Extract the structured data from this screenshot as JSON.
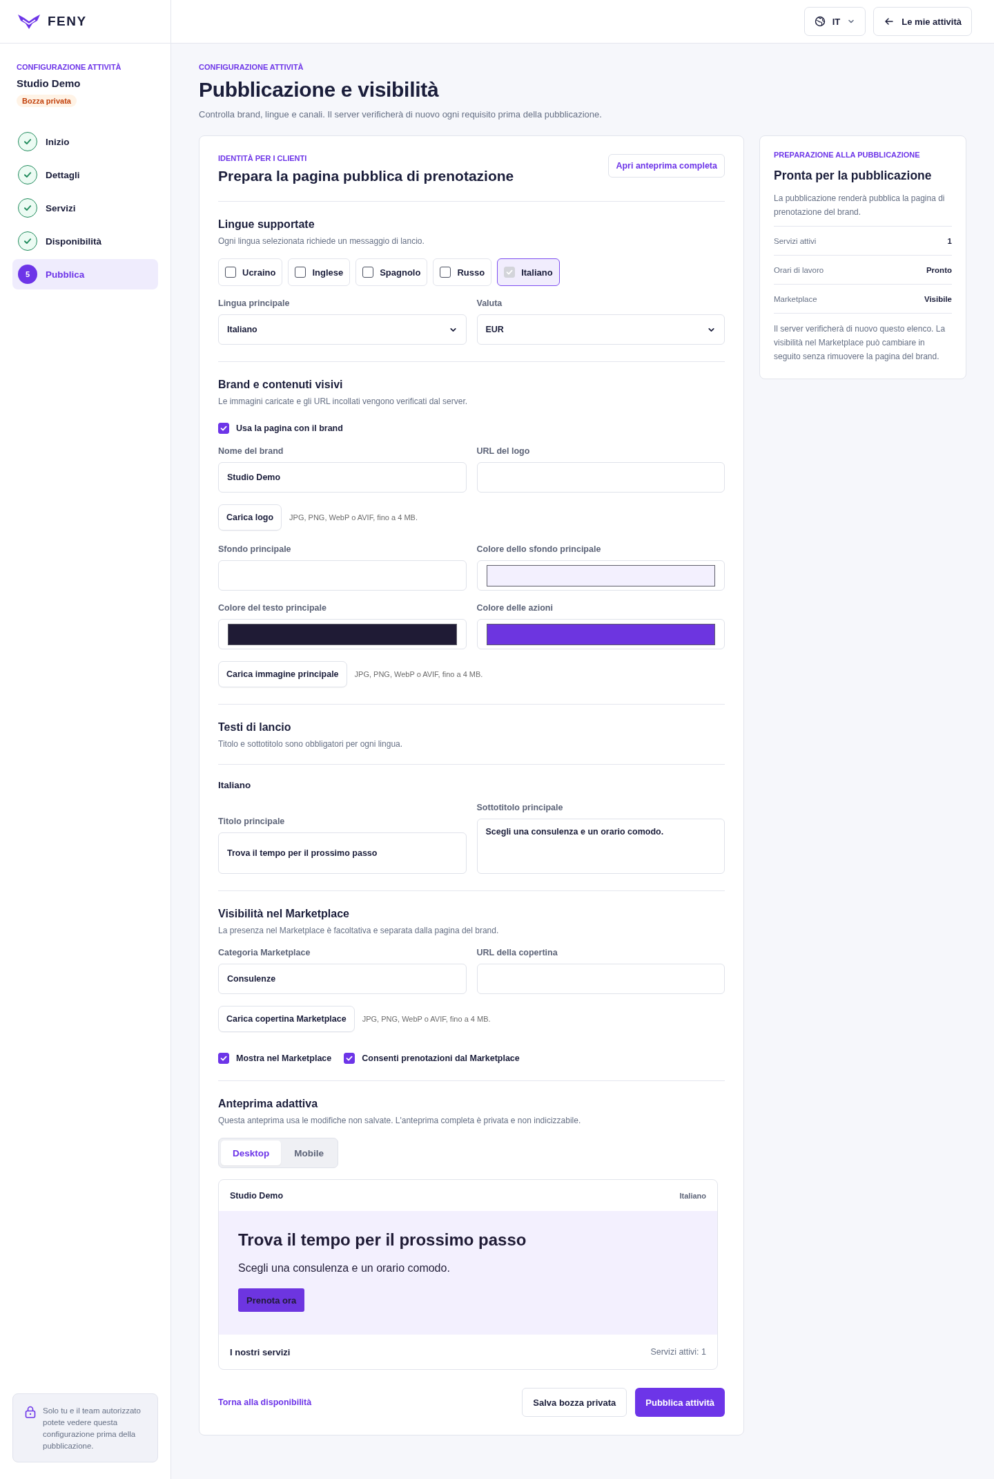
{
  "brand": {
    "name": "FENY"
  },
  "header": {
    "language": "IT",
    "back_button": "Le mie attività"
  },
  "sidebar": {
    "eyebrow": "CONFIGURAZIONE ATTIVITÀ",
    "title": "Studio Demo",
    "badge": "Bozza privata",
    "steps": [
      {
        "label": "Inizio",
        "done": true,
        "selected": false
      },
      {
        "label": "Dettagli",
        "done": true,
        "selected": false
      },
      {
        "label": "Servizi",
        "done": true,
        "selected": false
      },
      {
        "label": "Disponibilità",
        "done": true,
        "selected": false
      },
      {
        "label": "Pubblica",
        "number": "5",
        "done": false,
        "selected": true
      }
    ],
    "note": "Solo tu e il team autorizzato potete vedere questa configurazione prima della pubblicazione."
  },
  "page": {
    "eyebrow": "CONFIGURAZIONE ATTIVITÀ",
    "title": "Pubblicazione e visibilità",
    "subtitle": "Controlla brand, lingue e canali. Il server verificherà di nuovo ogni requisito prima della pubblicazione."
  },
  "card": {
    "eyebrow": "IDENTITÀ PER I CLIENTI",
    "title": "Prepara la pagina pubblica di prenotazione",
    "preview_button": "Apri anteprima completa",
    "languages": {
      "title": "Lingue supportate",
      "hint": "Ogni lingua selezionata richiede un messaggio di lancio.",
      "options": [
        {
          "label": "Ucraino",
          "checked": false,
          "disabled": false
        },
        {
          "label": "Inglese",
          "checked": false,
          "disabled": false
        },
        {
          "label": "Spagnolo",
          "checked": false,
          "disabled": false
        },
        {
          "label": "Russo",
          "checked": false,
          "disabled": false
        },
        {
          "label": "Italiano",
          "checked": true,
          "disabled": true
        }
      ],
      "fields": [
        {
          "kind": "select",
          "label": "Lingua principale",
          "value": "Italiano"
        },
        {
          "kind": "select",
          "label": "Valuta",
          "value": "EUR"
        }
      ]
    },
    "branding": {
      "title": "Brand e contenuti visivi",
      "hint": "Le immagini caricate e gli URL incollati vengono verificati dal server.",
      "use_brand": {
        "label": "Usa la pagina con il brand",
        "checked": true
      },
      "items": [
        {
          "kind": "fields",
          "fields": [
            {
              "kind": "text",
              "label": "Nome del brand",
              "value": "Studio Demo"
            },
            {
              "kind": "text",
              "label": "URL del logo"
            }
          ]
        },
        {
          "kind": "upload",
          "button": "Carica logo",
          "hint": "JPG, PNG, WebP o AVIF, fino a 4 MB."
        },
        {
          "kind": "fields",
          "fields": [
            {
              "kind": "text",
              "label": "Sfondo principale"
            },
            {
              "kind": "color",
              "label": "Colore dello sfondo principale",
              "color": "#f3f0fe"
            }
          ]
        },
        {
          "kind": "fields",
          "fields": [
            {
              "kind": "color",
              "label": "Colore del testo principale",
              "color": "#1f1b35"
            },
            {
              "kind": "color",
              "label": "Colore delle azioni",
              "color": "#6d35e0"
            }
          ]
        },
        {
          "kind": "upload",
          "button": "Carica immagine principale",
          "hint": "JPG, PNG, WebP o AVIF, fino a 4 MB."
        }
      ]
    },
    "launch": {
      "title": "Testi di lancio",
      "hint": "Titolo e sottotitolo sono obbligatori per ogni lingua.",
      "language": "Italiano",
      "fields": [
        {
          "kind": "text",
          "label": "Titolo principale",
          "value": "Trova il tempo per il prossimo passo"
        },
        {
          "kind": "textarea",
          "label": "Sottotitolo principale",
          "value": "Scegli una consulenza e un orario comodo."
        }
      ]
    },
    "marketplace": {
      "title": "Visibilità nel Marketplace",
      "hint": "La presenza nel Marketplace è facoltativa e separata dalla pagina del brand.",
      "items": [
        {
          "kind": "fields",
          "fields": [
            {
              "kind": "text",
              "label": "Categoria Marketplace",
              "value": "Consulenze"
            },
            {
              "kind": "text",
              "label": "URL della copertina"
            }
          ]
        },
        {
          "kind": "upload",
          "button": "Carica copertina Marketplace",
          "hint": "JPG, PNG, WebP o AVIF, fino a 4 MB."
        }
      ],
      "checkboxes": [
        {
          "label": "Mostra nel Marketplace",
          "checked": true
        },
        {
          "label": "Consenti prenotazioni dal Marketplace",
          "checked": true
        }
      ]
    },
    "preview": {
      "title": "Anteprima adattiva",
      "hint": "Questa anteprima usa le modifiche non salvate. L'anteprima completa è privata e non indicizzabile.",
      "tabs": [
        {
          "label": "Desktop",
          "selected": true
        },
        {
          "label": "Mobile",
          "selected": false
        }
      ],
      "frame": {
        "brand": "Studio Demo",
        "language": "Italiano",
        "headline": "Trova il tempo per il prossimo passo",
        "subtitle": "Scegli una consulenza e un orario comodo.",
        "cta": "Prenota ora",
        "footer_title": "I nostri servizi",
        "footer_count": "Servizi attivi: 1"
      }
    },
    "actions": {
      "back_link": "Torna alla disponibilità",
      "secondary": "Salva bozza privata",
      "primary": "Pubblica attività"
    }
  },
  "readiness": {
    "eyebrow": "PREPARAZIONE ALLA PUBBLICAZIONE",
    "title": "Pronta per la pubblicazione",
    "text": "La pubblicazione renderà pubblica la pagina di prenotazione del brand.",
    "rows": [
      {
        "label": "Servizi attivi",
        "value": "1"
      },
      {
        "label": "Orari di lavoro",
        "value": "Pronto"
      },
      {
        "label": "Marketplace",
        "value": "Visibile"
      }
    ],
    "note": "Il server verificherà di nuovo questo elenco. La visibilità nel Marketplace può cambiare in seguito senza rimuovere la pagina del brand."
  }
}
